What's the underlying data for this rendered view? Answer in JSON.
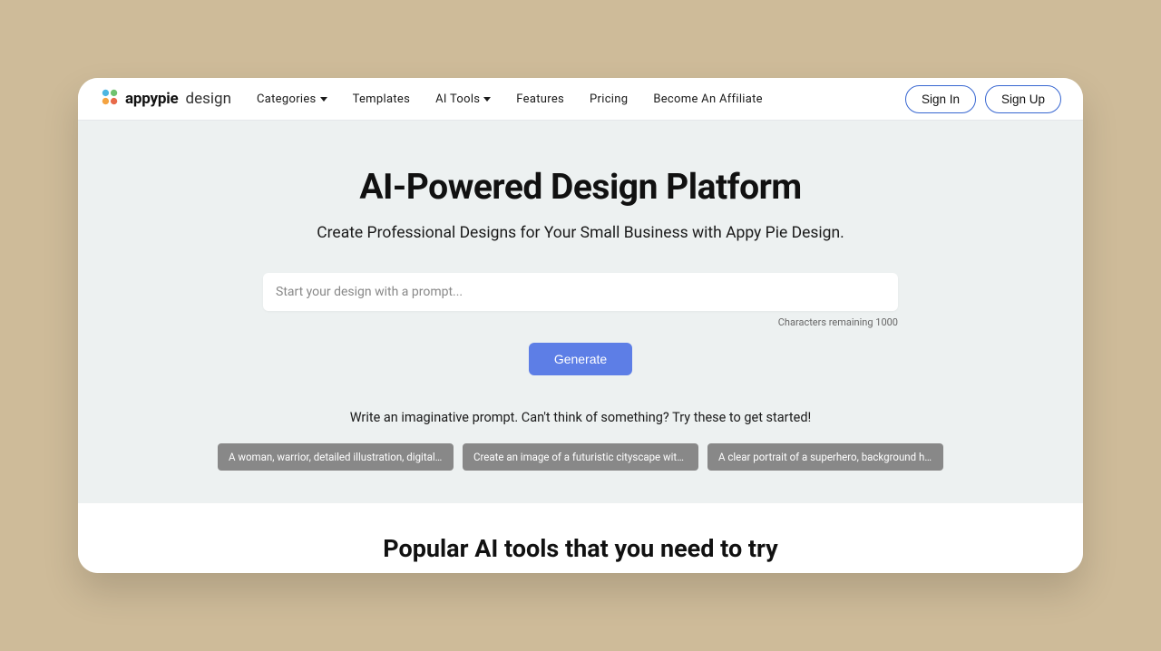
{
  "logo": {
    "main": "appypie",
    "sub": "design"
  },
  "nav": {
    "categories": "Categories",
    "templates": "Templates",
    "ai_tools": "AI Tools",
    "features": "Features",
    "pricing": "Pricing",
    "affiliate": "Become An Affiliate"
  },
  "auth": {
    "signin": "Sign In",
    "signup": "Sign Up"
  },
  "hero": {
    "title": "AI-Powered Design Platform",
    "subtitle": "Create Professional Designs for Your Small Business with Appy Pie Design.",
    "placeholder": "Start your design with a prompt...",
    "char_label": "Characters remaining 1000",
    "generate": "Generate",
    "suggest_text": "Write an imaginative prompt. Can't think of something? Try these to get started!",
    "chips": [
      "A woman, warrior, detailed illustration, digital art, ov...",
      "Create an image of a futuristic cityscape with towe...",
      "A clear portrait of a superhero, background hyper-..."
    ]
  },
  "popular": {
    "title": "Popular AI tools that you need to try"
  }
}
